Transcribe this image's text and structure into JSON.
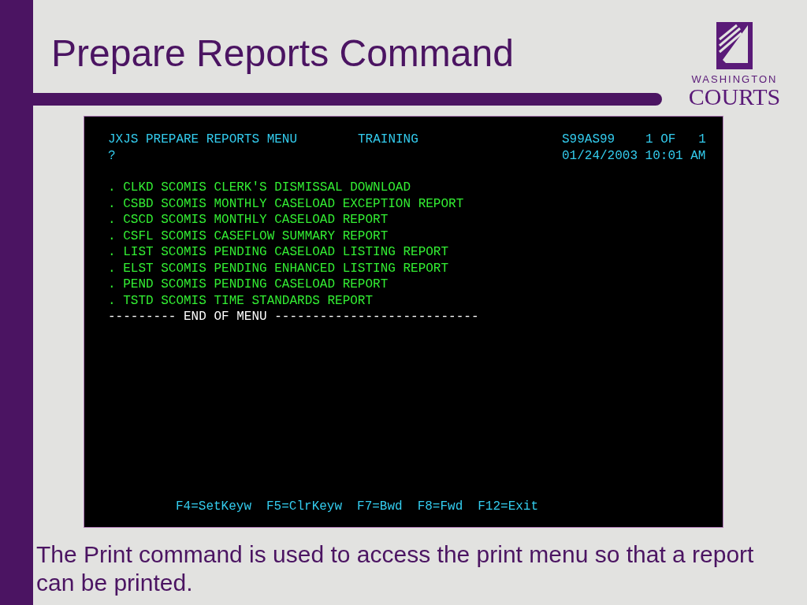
{
  "slide": {
    "title": "Prepare Reports Command",
    "logo": {
      "line_1": "WASHINGTON",
      "line_2": "COURTS"
    },
    "caption": "The Print command is used to access the print menu so that a report can be printed."
  },
  "terminal": {
    "title": "JXJS PREPARE REPORTS MENU",
    "mode": "TRAINING",
    "user_id": "S99AS99",
    "page": "1 OF   1",
    "prompt": "?",
    "datetime": "01/24/2003 10:01 AM",
    "menu_items": [
      ". CLKD SCOMIS CLERK'S DISMISSAL DOWNLOAD",
      ". CSBD SCOMIS MONTHLY CASELOAD EXCEPTION REPORT",
      ". CSCD SCOMIS MONTHLY CASELOAD REPORT",
      ". CSFL SCOMIS CASEFLOW SUMMARY REPORT",
      ". LIST SCOMIS PENDING CASELOAD LISTING REPORT",
      ". ELST SCOMIS PENDING ENHANCED LISTING REPORT",
      ". PEND SCOMIS PENDING CASELOAD REPORT",
      ". TSTD SCOMIS TIME STANDARDS REPORT"
    ],
    "end_of_menu": "--------- END OF MENU ---------------------------",
    "function_keys": [
      "F4=SetKeyw",
      "F5=ClrKeyw",
      "F7=Bwd",
      "F8=Fwd",
      "F12=Exit"
    ]
  }
}
